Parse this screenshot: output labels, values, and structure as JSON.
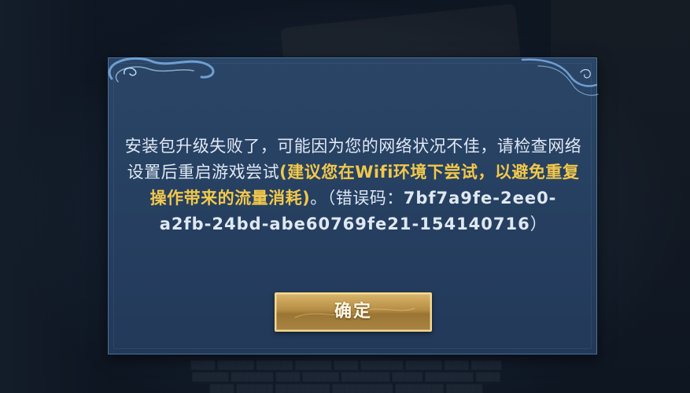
{
  "dialog": {
    "message": {
      "part1": "安装包升级失败了，可能因为您的网络状况不佳，请检查网络设置后重启游戏尝试",
      "highlight": "(建议您在Wifi环境下尝试，以避免重复操作带来的流量消耗)",
      "part2": "。（错误码：",
      "error_code": "7bf7a9fe-2ee0-a2fb-24bd-abe60769fe21-154140716",
      "part3": "）"
    },
    "confirm_label": "确定"
  },
  "colors": {
    "dialog_bg": "#274162",
    "highlight_text": "#f2c84b",
    "button_gold": "#b58c43"
  },
  "icons": {
    "swirl": "cloud-swirl-ornament"
  }
}
